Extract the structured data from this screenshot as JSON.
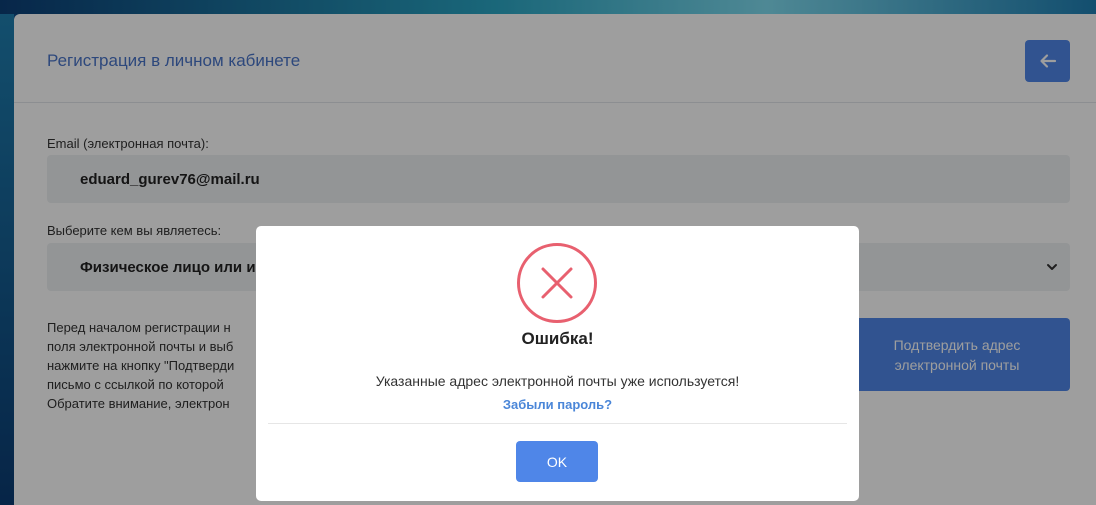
{
  "page": {
    "title": "Регистрация в личном кабинете",
    "back_icon": "arrow-left-icon"
  },
  "form": {
    "email_label": "Email (электронная почта):",
    "email_value": "eduard_gurev76@mail.ru",
    "role_label": "Выберите кем вы являетесь:",
    "role_value": "Физическое лицо или ин",
    "info_text": "Перед началом регистрации н\nполя электронной почты и выб\nнажмите на кнопку \"Подтверди\nписьмо с ссылкой по которой \nОбратите внимание, электрон",
    "confirm_label": "Подтвердить адрес электронной почты"
  },
  "dialog": {
    "icon": "error-x-icon",
    "title": "Ошибка!",
    "message": "Указанные адрес электронной почты уже используется!",
    "forgot_link": "Забыли пароль?",
    "ok_label": "OK"
  },
  "colors": {
    "accent": "#4f86e8",
    "title": "#4a74c9",
    "error": "#e8606f",
    "link": "#4a86d8"
  }
}
